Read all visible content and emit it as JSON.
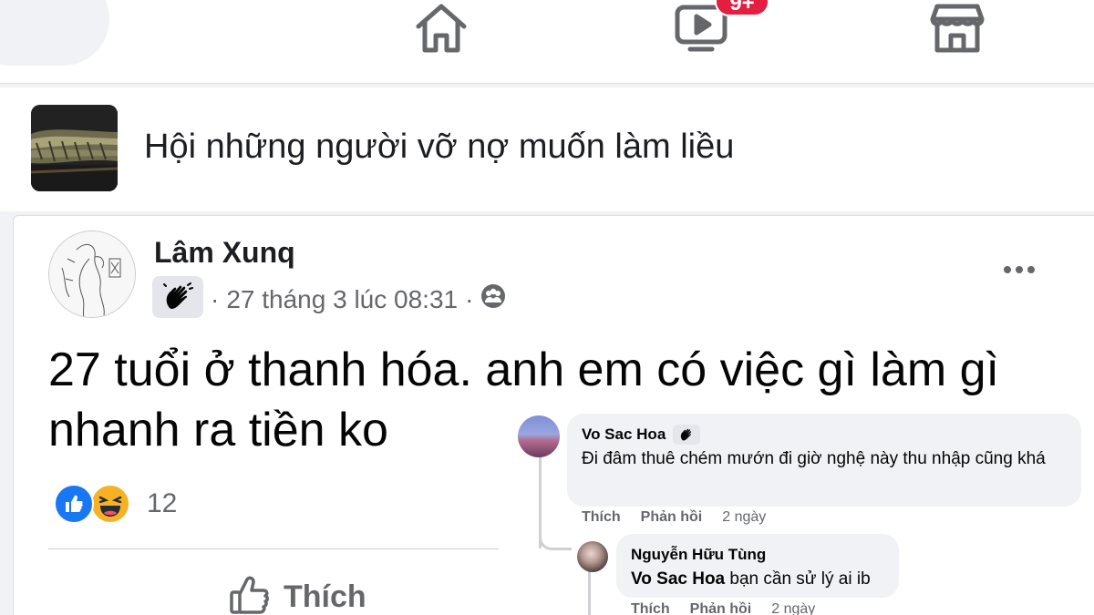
{
  "nav": {
    "items": [
      {
        "name": "home-icon"
      },
      {
        "name": "video-icon",
        "badge": "9+"
      },
      {
        "name": "marketplace-icon"
      }
    ],
    "badge_color": "#e41e3f"
  },
  "group": {
    "name": "Hội những người vỡ nợ muốn làm liều"
  },
  "post": {
    "author": "Lâm Xunq",
    "badge_icon": "wave-hand-icon",
    "timestamp": "27 tháng 3 lúc 08:31",
    "separator": "·",
    "audience_icon": "group-audience-icon",
    "text": "27 tuổi ở thanh hóa. anh em có việc gì làm gì nhanh ra tiền ko",
    "reactions": [
      "like-reaction-icon",
      "haha-reaction-icon"
    ],
    "reaction_count": "12",
    "like_label": "Thích"
  },
  "comments": [
    {
      "author": "Vo Sac Hoa",
      "badge_icon": "wave-hand-icon",
      "text": "Đi đâm thuê chém mướn đi giờ nghệ này thu nhập cũng khá",
      "like_label": "Thích",
      "reply_label": "Phản hồi",
      "time": "2 ngày"
    },
    {
      "author": "Nguyễn Hữu Tùng",
      "mention": "Vo Sac Hoa",
      "text": " bạn cần sử lý ai ib",
      "like_label": "Thích",
      "reply_label": "Phản hồi",
      "time": "2 ngày"
    }
  ],
  "colors": {
    "accent": "#1877f2",
    "secondary_text": "#65676b"
  }
}
